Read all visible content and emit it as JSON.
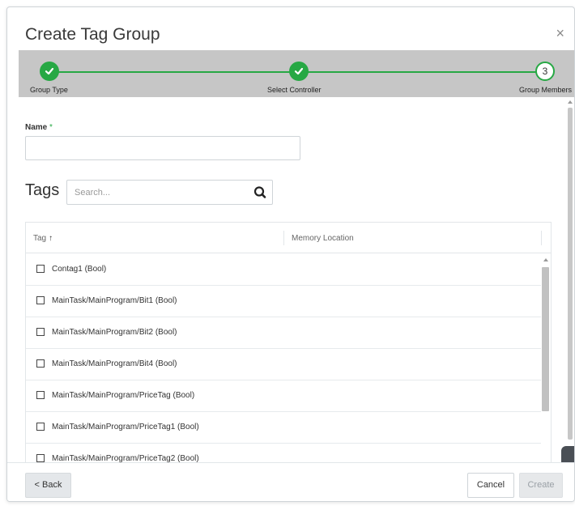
{
  "dialog": {
    "title": "Create Tag Group",
    "close_label": "×"
  },
  "stepper": {
    "steps": [
      {
        "label": "Group Type",
        "state": "done"
      },
      {
        "label": "Select Controller",
        "state": "done"
      },
      {
        "label": "Group Members",
        "state": "current",
        "number": "3"
      }
    ]
  },
  "form": {
    "name_label": "Name",
    "name_required": "*",
    "name_value": ""
  },
  "tags": {
    "title": "Tags",
    "search_placeholder": "Search...",
    "columns": {
      "tag": "Tag",
      "sort_arrow": "↑",
      "memory_location": "Memory Location"
    },
    "rows": [
      {
        "label": "Contag1 (Bool)",
        "checked": false
      },
      {
        "label": "MainTask/MainProgram/Bit1 (Bool)",
        "checked": false
      },
      {
        "label": "MainTask/MainProgram/Bit2 (Bool)",
        "checked": false
      },
      {
        "label": "MainTask/MainProgram/Bit4 (Bool)",
        "checked": false
      },
      {
        "label": "MainTask/MainProgram/PriceTag (Bool)",
        "checked": false
      },
      {
        "label": "MainTask/MainProgram/PriceTag1 (Bool)",
        "checked": false
      },
      {
        "label": "MainTask/MainProgram/PriceTag2 (Bool)",
        "checked": false
      }
    ]
  },
  "footer": {
    "back_label": "< Back",
    "cancel_label": "Cancel",
    "create_label": "Create"
  },
  "colors": {
    "accent_green": "#27a844",
    "stepper_bg": "#c6c6c6"
  }
}
